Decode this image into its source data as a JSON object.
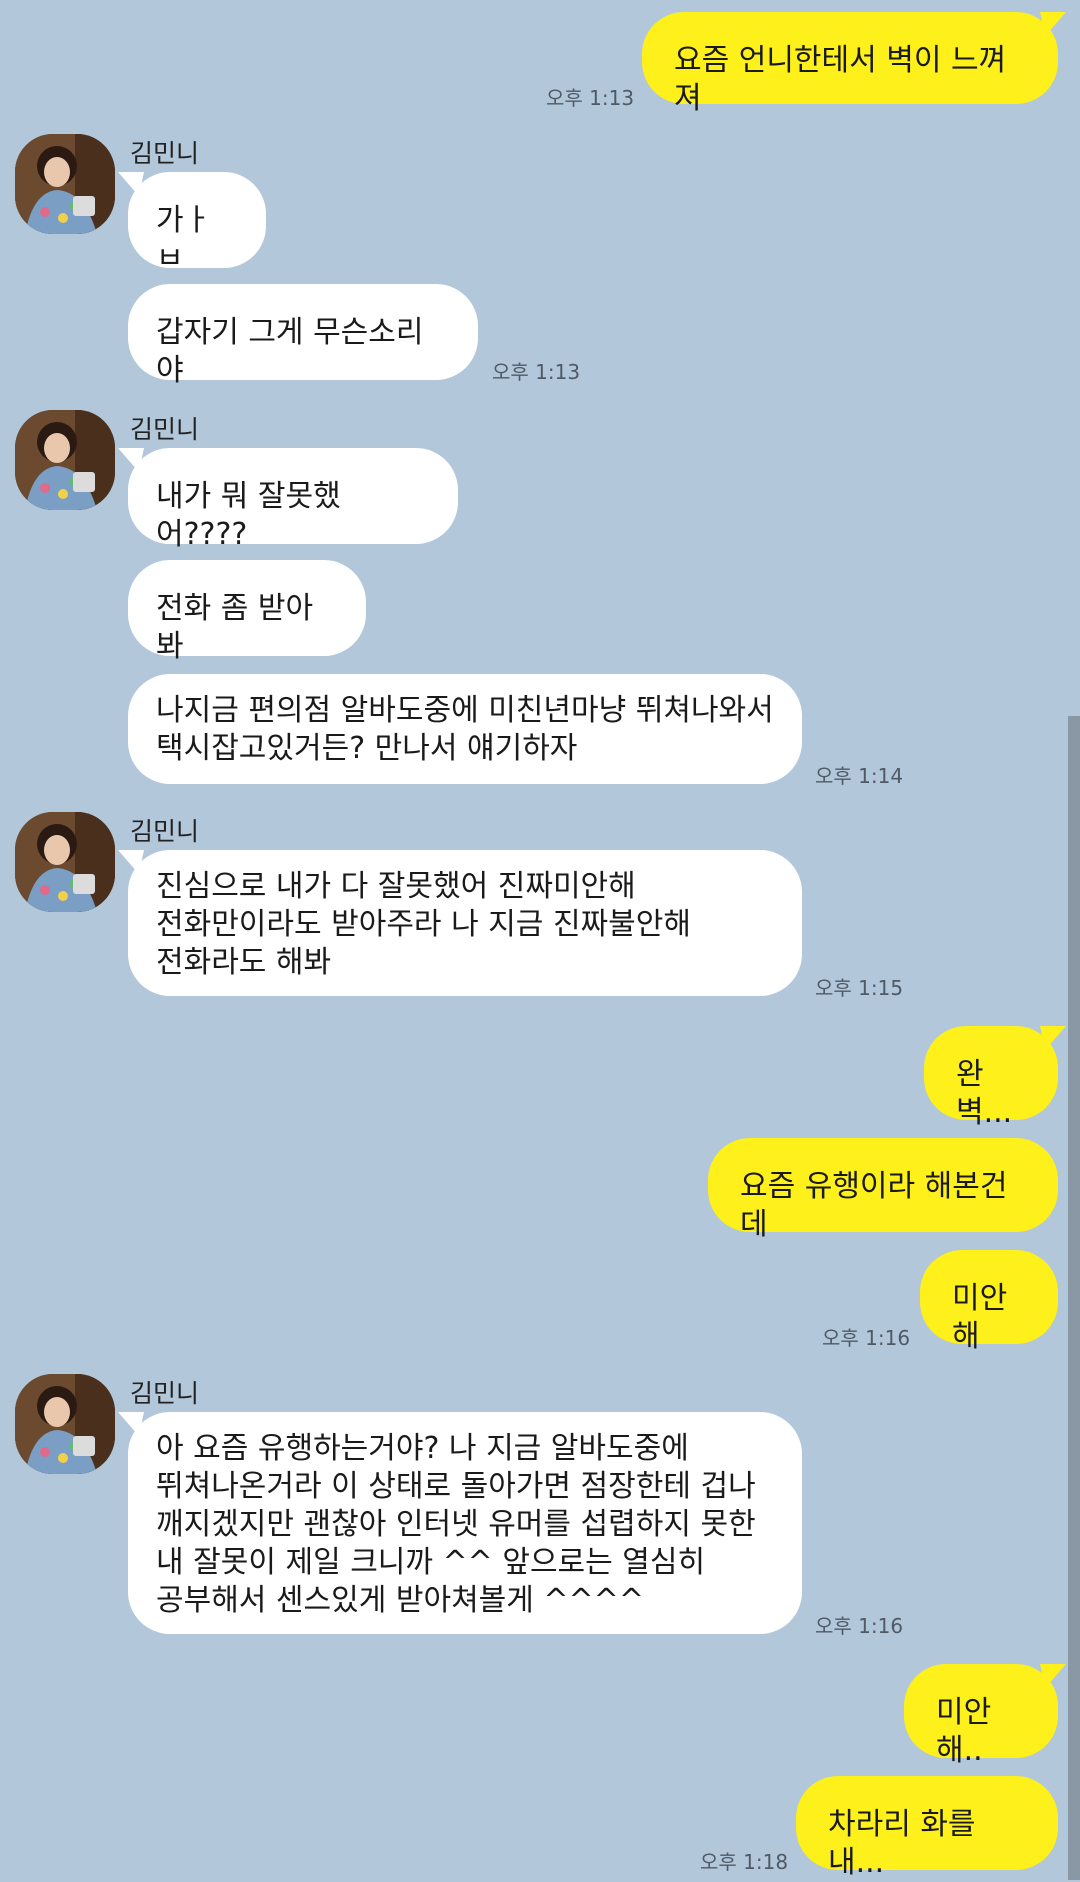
{
  "conversation": {
    "contact_name": "김민니",
    "messages": [
      {
        "from": "me",
        "text": "요즘 언니한테서 벽이 느껴져",
        "time": "오후 1:13"
      },
      {
        "from": "contact",
        "text": "가ㅏㅂ"
      },
      {
        "from": "contact",
        "text": "갑자기 그게 무슨소리야",
        "time": "오후 1:13"
      },
      {
        "from": "contact",
        "text": "내가 뭐 잘못했어????"
      },
      {
        "from": "contact",
        "text": "전화 좀 받아봐"
      },
      {
        "from": "contact",
        "text": "나지금 편의점 알바도중에 미친년마냥 뛰쳐나와서\n택시잡고있거든? 만나서 얘기하자",
        "time": "오후 1:14"
      },
      {
        "from": "contact",
        "text": "진심으로 내가 다 잘못했어 진짜미안해\n전화만이라도 받아주라 나 지금 진짜불안해\n전화라도 해봐",
        "time": "오후 1:15"
      },
      {
        "from": "me",
        "text": "완벽..."
      },
      {
        "from": "me",
        "text": "요즘 유행이라 해본건데"
      },
      {
        "from": "me",
        "text": "미안해",
        "time": "오후 1:16"
      },
      {
        "from": "contact",
        "text": "아 요즘 유행하는거야? 나 지금 알바도중에\n뛰쳐나온거라 이 상태로 돌아가면 점장한테 겁나\n깨지겠지만 괜찮아 인터넷 유머를 섭렵하지 못한\n내 잘못이 제일 크니까 ^^ 앞으로는 열심히\n공부해서 센스있게 받아쳐볼게 ^^^^",
        "time": "오후 1:16"
      },
      {
        "from": "me",
        "text": "미안해.."
      },
      {
        "from": "me",
        "text": "차라리 화를 내...",
        "time": "오후 1:18"
      }
    ]
  },
  "colors": {
    "background": "#b2c7da",
    "sent_bubble": "#fef01b",
    "received_bubble": "#ffffff"
  }
}
